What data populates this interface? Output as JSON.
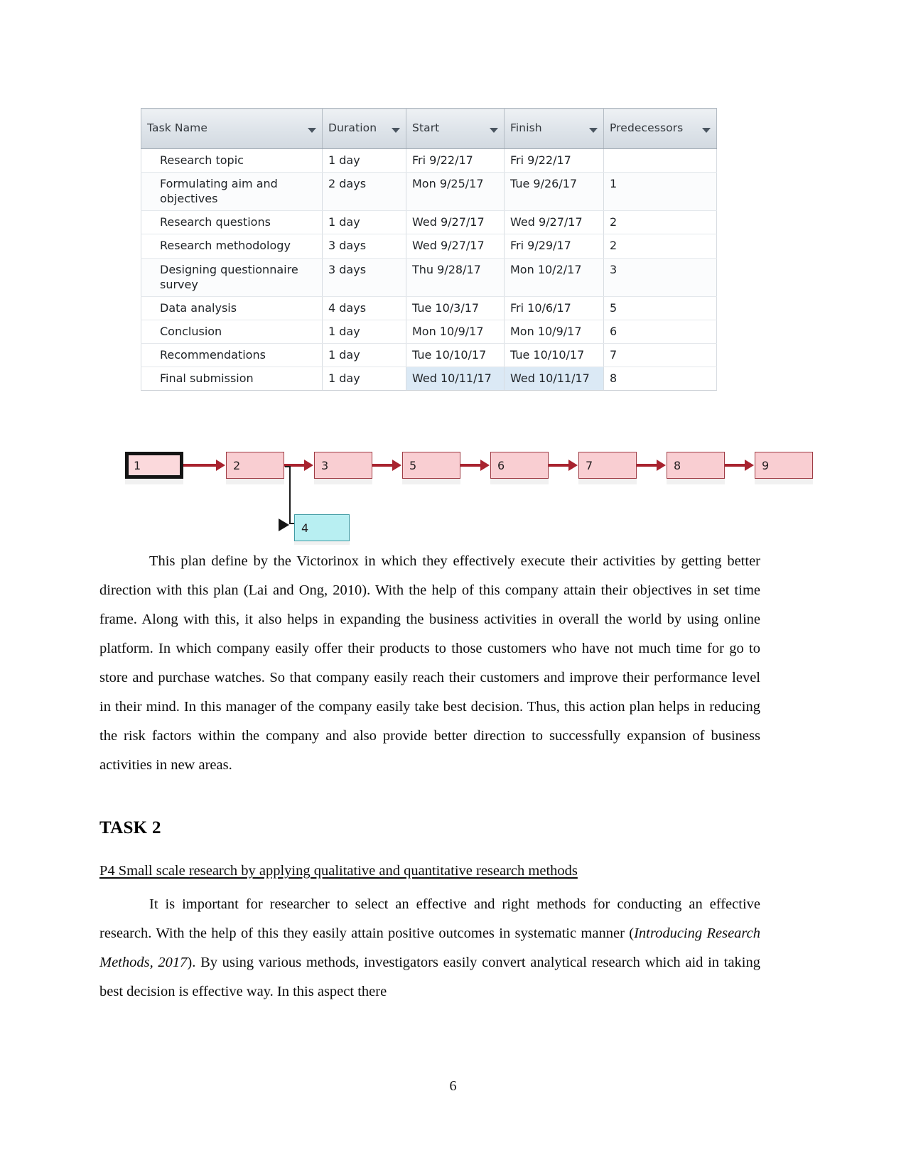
{
  "document": {
    "page_number": "6"
  },
  "project_table": {
    "columns": [
      {
        "label": "Task Name",
        "has_filter": true
      },
      {
        "label": "Duration",
        "has_filter": true
      },
      {
        "label": "Start",
        "has_filter": true
      },
      {
        "label": "Finish",
        "has_filter": true
      },
      {
        "label": "Predecessors",
        "has_filter": true
      }
    ],
    "rows": [
      {
        "task": "Research topic",
        "duration": "1 day",
        "start": "Fri 9/22/17",
        "finish": "Fri 9/22/17",
        "predecessors": ""
      },
      {
        "task": "Formulating aim and objectives",
        "duration": "2 days",
        "start": "Mon 9/25/17",
        "finish": "Tue 9/26/17",
        "predecessors": "1"
      },
      {
        "task": "Research questions",
        "duration": "1 day",
        "start": "Wed 9/27/17",
        "finish": "Wed 9/27/17",
        "predecessors": "2"
      },
      {
        "task": "Research methodology",
        "duration": "3 days",
        "start": "Wed 9/27/17",
        "finish": "Fri 9/29/17",
        "predecessors": "2"
      },
      {
        "task": "Designing questionnaire survey",
        "duration": "3 days",
        "start": "Thu 9/28/17",
        "finish": "Mon 10/2/17",
        "predecessors": "3"
      },
      {
        "task": "Data analysis",
        "duration": "4 days",
        "start": "Tue 10/3/17",
        "finish": "Fri 10/6/17",
        "predecessors": "5"
      },
      {
        "task": "Conclusion",
        "duration": "1 day",
        "start": "Mon 10/9/17",
        "finish": "Mon 10/9/17",
        "predecessors": "6"
      },
      {
        "task": "Recommendations",
        "duration": "1 day",
        "start": "Tue 10/10/17",
        "finish": "Tue 10/10/17",
        "predecessors": "7"
      },
      {
        "task": "Final submission",
        "duration": "1 day",
        "start": "Wed 10/11/17",
        "finish": "Wed 10/11/17",
        "predecessors": "8",
        "highlight": true
      }
    ],
    "header_bg": "#dde3e9",
    "highlight_color": "#dbe9f5"
  },
  "network_diagram": {
    "nodes": [
      {
        "id": "1",
        "label": "1",
        "style": "selected"
      },
      {
        "id": "2",
        "label": "2",
        "style": "normal"
      },
      {
        "id": "3",
        "label": "3",
        "style": "normal"
      },
      {
        "id": "5",
        "label": "5",
        "style": "normal"
      },
      {
        "id": "6",
        "label": "6",
        "style": "normal"
      },
      {
        "id": "7",
        "label": "7",
        "style": "normal"
      },
      {
        "id": "8",
        "label": "8",
        "style": "normal"
      },
      {
        "id": "9",
        "label": "9",
        "style": "normal"
      },
      {
        "id": "4",
        "label": "4",
        "style": "cyan"
      }
    ],
    "edges": [
      {
        "from": "1",
        "to": "2"
      },
      {
        "from": "2",
        "to": "3"
      },
      {
        "from": "3",
        "to": "5"
      },
      {
        "from": "5",
        "to": "6"
      },
      {
        "from": "6",
        "to": "7"
      },
      {
        "from": "7",
        "to": "8"
      },
      {
        "from": "8",
        "to": "9"
      },
      {
        "from": "2",
        "to": "4"
      }
    ],
    "colors": {
      "node_fill": "#f9ced2",
      "node_border": "#9e3b44",
      "cyan_fill": "#b8eff2",
      "cyan_border": "#3f9aa3",
      "connector": "#a8232f",
      "branch": "#1c1c1c"
    }
  },
  "content": {
    "paragraph_1": "This plan define by the Victorinox in which they effectively execute their activities by getting better direction with this plan (Lai and Ong, 2010). With the help of this company attain their objectives in set time frame. Along with this, it also helps in expanding the business activities in overall the world by using online platform. In which company easily offer their products to those customers who have not much time for go to store and purchase watches. So that company easily reach their customers and improve their performance level in their mind. In this manager of the company easily take best decision. Thus, this action plan helps in reducing the risk factors within the company and also provide better direction to successfully expansion of business activities in new areas.",
    "task_heading": "TASK 2",
    "sub_heading": "P4 Small scale research by applying qualitative and quantitative research methods",
    "paragraph_2_part1": "It is important for researcher to select an effective and right methods for conducting an effective research. With the help of this they easily attain  positive outcomes in systematic manner (",
    "paragraph_2_citation": "Introducing Research Methods, 2017",
    "paragraph_2_part2": "). By using various methods, investigators easily convert analytical research which aid in taking best decision is effective way. In this aspect there"
  }
}
